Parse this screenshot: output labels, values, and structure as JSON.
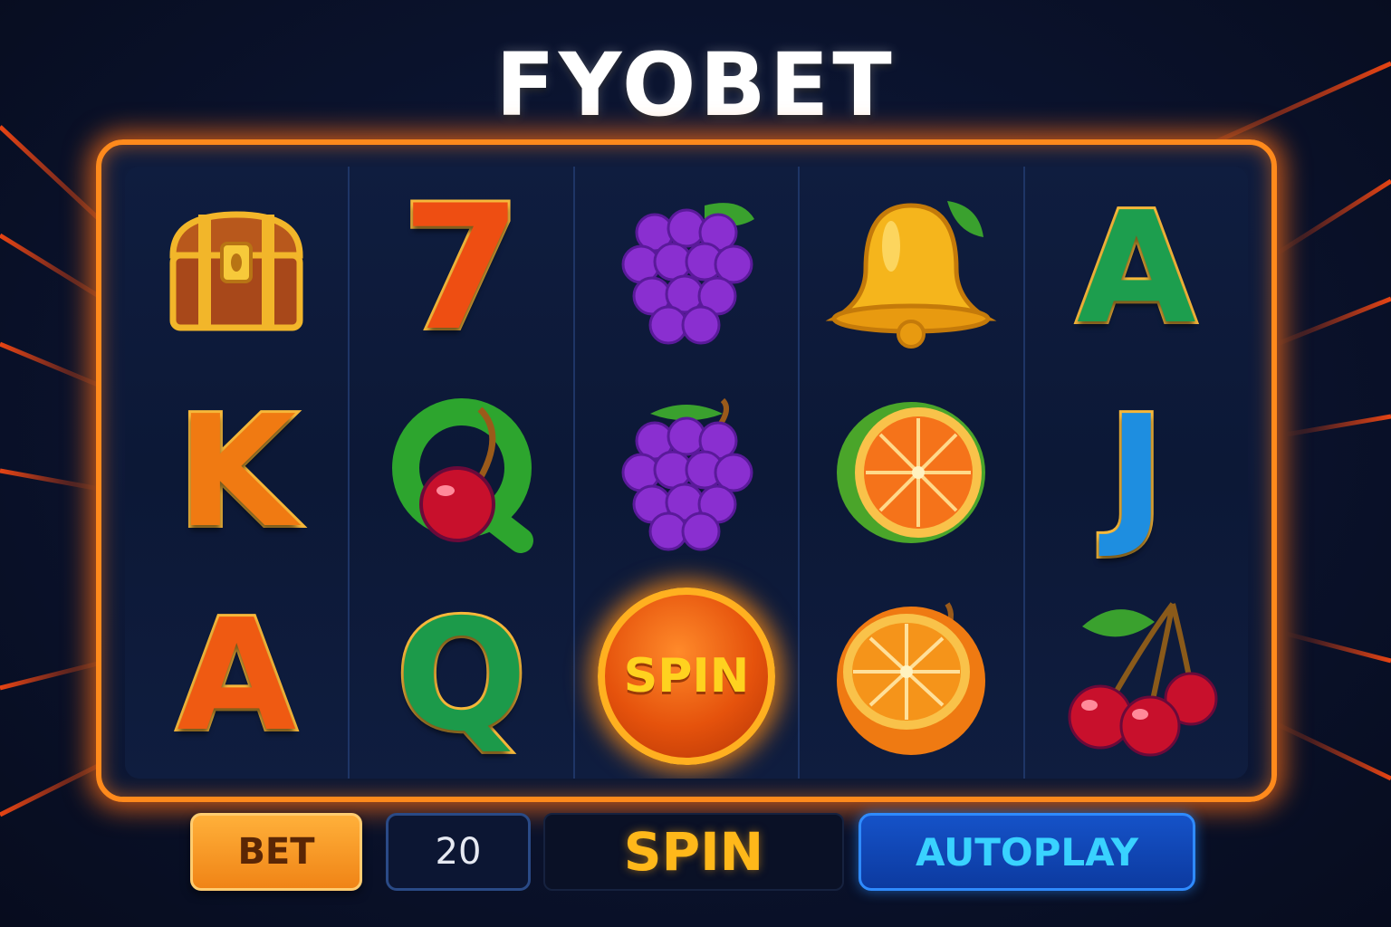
{
  "title": "FYOBET",
  "colors": {
    "frame": "#ff8a1c",
    "background": "#0b1430",
    "accent_blue": "#2f8bff",
    "accent_orange": "#f08416"
  },
  "reels": [
    [
      {
        "symbol": "treasure-chest-icon"
      },
      {
        "symbol": "letter-K",
        "text": "K",
        "color": "#f07a12"
      },
      {
        "symbol": "letter-A",
        "text": "A",
        "color": "#ef5a12"
      }
    ],
    [
      {
        "symbol": "seven-icon",
        "text": "7",
        "color": "#ee4e12"
      },
      {
        "symbol": "q-cherry-icon"
      },
      {
        "symbol": "letter-Q",
        "text": "Q",
        "color": "#1c9a4a"
      }
    ],
    [
      {
        "symbol": "grapes-icon"
      },
      {
        "symbol": "grapes-icon"
      },
      {
        "symbol": "spin-orb",
        "text": "SPIN"
      }
    ],
    [
      {
        "symbol": "bell-icon"
      },
      {
        "symbol": "orange-half-icon"
      },
      {
        "symbol": "orange-icon"
      }
    ],
    [
      {
        "symbol": "letter-A",
        "text": "A",
        "color": "#1d9e4e"
      },
      {
        "symbol": "letter-J",
        "text": "J",
        "color": "#1e8ee0"
      },
      {
        "symbol": "cherries-icon"
      }
    ]
  ],
  "controls": {
    "bet_label": "BET",
    "bet_value": "20",
    "spin_label": "SPIN",
    "autoplay_label": "AUTOPLAY"
  }
}
